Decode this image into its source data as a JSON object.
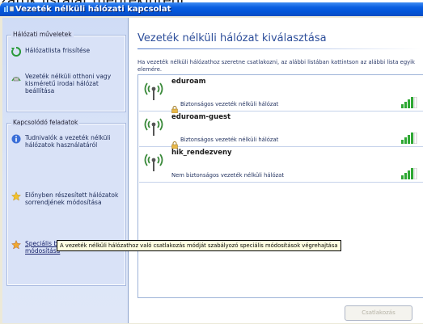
{
  "page": {
    "top_caption": "zatok listáját megtekinteni."
  },
  "window": {
    "title": "Vezeték nélküli hálózati kapcsolat"
  },
  "sidebar": {
    "network_tasks": {
      "title": "Hálózati műveletek",
      "items": [
        {
          "label": "Hálózatlista frissítése",
          "icon": "refresh-icon"
        },
        {
          "label": "Vezeték nélküli otthoni vagy kisméretű irodai hálózat beállítása",
          "icon": "home-network-icon"
        }
      ]
    },
    "related_tasks": {
      "title": "Kapcsolódó feladatok",
      "items": [
        {
          "label": "Tudnivalók a vezeték nélküli hálózatok használatáról",
          "icon": "info-icon"
        },
        {
          "label": "Előnyben részesített hálózatok sorrendjének módosítása",
          "icon": "star-icon"
        },
        {
          "label": "Speciális beállítások módosítása",
          "icon": "settings-star-icon"
        }
      ]
    }
  },
  "main": {
    "heading": "Vezeték nélküli hálózat kiválasztása",
    "intro": "Ha vezeték nélküli hálózathoz szeretne csatlakozni, az alábbi listában kattintson az alábbi lista egyik elemére.",
    "networks": [
      {
        "name": "eduroam",
        "status": "Biztonságos vezeték nélküli hálózat",
        "secured": true,
        "signal_bars": 4
      },
      {
        "name": "eduroam-guest",
        "status": "Biztonságos vezeték nélküli hálózat",
        "secured": true,
        "signal_bars": 4
      },
      {
        "name": "hik_rendezveny",
        "status": "Nem biztonságos vezeték nélküli hálózat",
        "secured": false,
        "signal_bars": 4
      }
    ],
    "connect_button": "Csatlakozás"
  },
  "tooltip": {
    "text": "A vezeték nélküli hálózathoz való csatlakozás módját szabályozó speciális módosítások végrehajtása"
  },
  "colors": {
    "titlebar": "#0354d6",
    "heading": "#2d4e9a",
    "signal": "#2fa834",
    "lock": "#e8b84a"
  }
}
